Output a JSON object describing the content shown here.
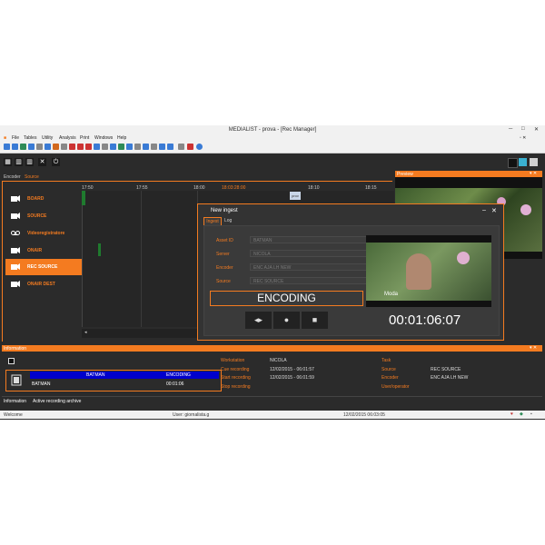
{
  "window": {
    "title": "MEDIALIST - prova - [Rec Manager]"
  },
  "menu": [
    "File",
    "Tables",
    "Utility",
    "Analysis",
    "Print",
    "Windows",
    "Help"
  ],
  "encoder_tabs": {
    "encoder": "Encoder",
    "source": "Source"
  },
  "timeline": {
    "ticks": [
      "17:50",
      "17:55",
      "18:00",
      "18:03:28:00",
      "18:10",
      "18:15"
    ],
    "clip_label": "prov"
  },
  "sources": [
    "BOARD",
    "SOURCE",
    "Videoregistratore",
    "ONAIR",
    "REC SOURCE",
    "ONAIR DEST"
  ],
  "preview": {
    "title": "Preview"
  },
  "dialog": {
    "title": "New ingest",
    "tabs": [
      "Ingest",
      "Log"
    ],
    "fields": [
      {
        "label": "Asset ID",
        "value": "BATMAN"
      },
      {
        "label": "Server",
        "value": "NICOLA"
      },
      {
        "label": "Encoder",
        "value": "ENC AJA LH NEW"
      },
      {
        "label": "Source",
        "value": "REC SOURCE"
      }
    ],
    "status": "ENCODING",
    "timecode": "00:01:06:07",
    "logo": "Moda"
  },
  "information": {
    "title": "Information",
    "row": {
      "name": "BATMAN",
      "status": "ENCODING",
      "asset": "BATMAN",
      "duration": "00:01:06"
    },
    "details_left": [
      {
        "label": "Workstation",
        "value": "NICOLA"
      },
      {
        "label": "Cue recording",
        "value": "12/02/2015 - 06:01:57"
      },
      {
        "label": "Start recording",
        "value": "12/02/2015 - 06:01:59"
      },
      {
        "label": "Stop recording",
        "value": ""
      }
    ],
    "details_right": [
      {
        "label": "Task",
        "value": ""
      },
      {
        "label": "Source",
        "value": "REC SOURCE"
      },
      {
        "label": "Encoder",
        "value": "ENC AJA LH NEW"
      },
      {
        "label": "User/operator",
        "value": ""
      }
    ],
    "bottom_tabs": [
      "Information",
      "Active recording archive"
    ]
  },
  "statusbar": {
    "left": "Welcome",
    "user": "User: giornalista.g",
    "datetime": "12/02/2015 06:03:05"
  },
  "colors": {
    "accent": "#f47b20",
    "bg": "#2b2b2b",
    "selection": "#0000cc"
  }
}
